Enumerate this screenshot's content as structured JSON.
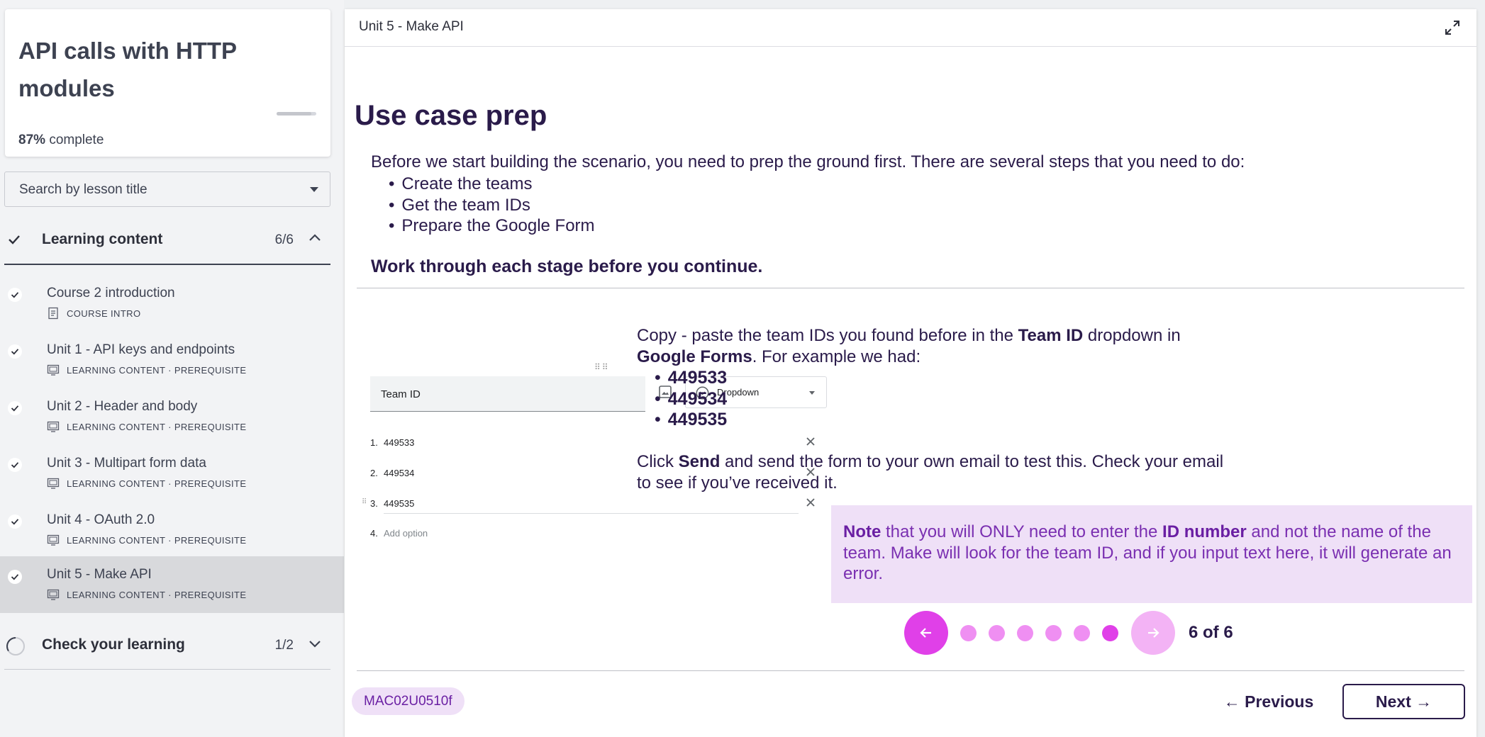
{
  "course": {
    "title": "API calls with HTTP modules",
    "progress_percent": "87%",
    "progress_suffix": "complete",
    "progress_value": 0.87
  },
  "search": {
    "placeholder": "Search by lesson title"
  },
  "sections": {
    "learning": {
      "name": "Learning content",
      "count": "6/6"
    },
    "check": {
      "name": "Check your learning",
      "count": "1/2"
    }
  },
  "lessons": [
    {
      "title": "Course 2 introduction",
      "type": "COURSE INTRO"
    },
    {
      "title": "Unit 1 - API keys and endpoints",
      "type": "LEARNING CONTENT · PREREQUISITE"
    },
    {
      "title": "Unit 2 - Header and body",
      "type": "LEARNING CONTENT · PREREQUISITE"
    },
    {
      "title": "Unit 3 - Multipart form data",
      "type": "LEARNING CONTENT · PREREQUISITE"
    },
    {
      "title": "Unit 4 - OAuth 2.0",
      "type": "LEARNING CONTENT · PREREQUISITE"
    },
    {
      "title": "Unit 5 - Make API",
      "type": "LEARNING CONTENT · PREREQUISITE"
    }
  ],
  "main": {
    "breadcrumb": "Unit 5 - Make API",
    "heading": "Use case prep",
    "intro": "Before we start building the scenario, you need to prep the ground first. There are several steps that you need to do:",
    "steps": [
      "Create the teams",
      "Get the team IDs",
      "Prepare the Google Form"
    ],
    "instruction": "Work through each stage before you continue.",
    "form_mock": {
      "field_label": "Team ID",
      "dropdown_label": "Dropdown",
      "options": [
        "449533",
        "449534",
        "449535"
      ],
      "numbers": [
        "1.",
        "2.",
        "3.",
        "4."
      ],
      "add_option": "Add option"
    },
    "copy_text": {
      "p1": "Copy - paste the team IDs you found before in the ",
      "b1": "Team ID",
      "p2": " dropdown in ",
      "b2": "Google Forms",
      "p3": ". For example we had:"
    },
    "example_ids": [
      "449533",
      "449534",
      "449535"
    ],
    "send_text": {
      "p1": "Click ",
      "b1": "Send",
      "p2": " and send the form to your own email to test this. Check your email to see if you’ve received it."
    },
    "note": {
      "b1": "Note",
      "p1": " that you will ONLY need to enter the ",
      "b2": "ID number",
      "p2": " and not the name of the team. Make will look for the team ID, and if you input text here, it will generate an error."
    },
    "carousel": {
      "position": "6 of 6",
      "total": 6,
      "current": 6
    },
    "code": "MAC02U0510f",
    "prev_label": "Previous",
    "next_label": "Next"
  },
  "colors": {
    "accent": "#e040e8",
    "accent_light": "#f3b3f5",
    "note_bg": "#efe0f7",
    "heading": "#2a1b4a"
  }
}
